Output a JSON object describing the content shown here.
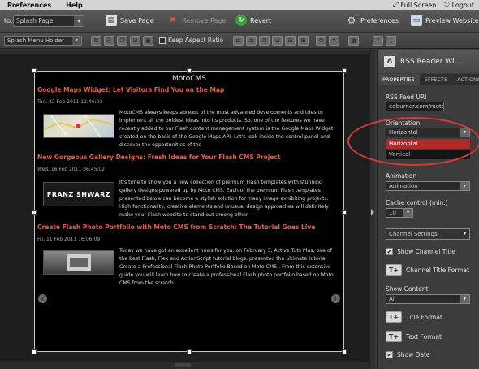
{
  "menubar": {
    "items": [
      "Preferences",
      "Help"
    ],
    "full_screen": "Full Screen",
    "logout": "Logout"
  },
  "toolbar": {
    "to_label": "to:",
    "page_select": "Splash Page",
    "save_page": "Save Page",
    "remove_page": "Remove Page",
    "revert": "Revert",
    "preferences": "Preferences",
    "preview_website": "Preview Website"
  },
  "toolbar2": {
    "holder_select": "Splash Menu Holder",
    "keep_aspect_ratio": "Keep Aspect Ratio"
  },
  "widget": {
    "title": "MotoCMS",
    "posts": [
      {
        "title": "Google Maps Widget: Let Visitors Find You on the Map",
        "date": "Tue, 22 Feb 2011 12:46:03",
        "body": "MotoCMS always keeps abreast of the most advanced developments and tries to implement all the boldest ideas into its products. So, one of the features we have recently added to our Flash content management system is the Google Maps Widget created on the basis of the Google Maps API. Let's look inside the control panel and discover the opportunities of the",
        "thumb_caption": ""
      },
      {
        "title": "New Gorgeous Gallery Designs: Fresh Ideas for Your Flash CMS Project",
        "date": "Wed, 16 Feb 2011 06:45:02",
        "body": "It's time to show you a new collection of premium Flash templates with stunning gallery designs powered up by Moto CMS. Each of the premium Flash templates presented below can become a stylish solution for many image exhibiting projects. High functionality, creative elements and unusual design approaches will definitely make your Flash website to stand out among other",
        "thumb_caption": "FRANZ SHWARZ"
      },
      {
        "title": "Create Flash Photo Portfolio with Moto CMS from Scratch: The Tutorial Goes Live",
        "date": "Fri, 11 Feb 2011 16:06:09",
        "body": "Today we have got an excellent news for you: on February 3, Active Tuts Plus, one of the best Flash, Flex and ActionScript tutorial blogs, presented the ultimate tutorial Create a Professional Flash Photo Portfolio Based on Moto CMS . From this extensive guide you will learn how to create a professional Flash photo portfolio based on Moto CMS from the scratch.",
        "thumb_caption": ""
      }
    ]
  },
  "panel": {
    "title": "RSS Reader Wi...",
    "tabs": [
      "PROPERTIES",
      "EFFECTS",
      "ACTIONS"
    ],
    "rss_feed_uri_label": "RSS Feed URI",
    "rss_feed_uri_value": "edburner.com/motocms/",
    "orientation_label": "Orientation",
    "orientation_value": "Horizontal",
    "orientation_options": [
      "Horizontal",
      "Vertical"
    ],
    "animation_label": "Animation",
    "animation_value": "Animation",
    "cache_label": "Cache control (min.)",
    "cache_value": "10",
    "channel_settings": "Channel Settings",
    "show_channel_title": "Show Channel Title",
    "channel_title_format": "Channel Title Format",
    "show_content_label": "Show Content",
    "show_content_value": "All",
    "title_format": "Title Format",
    "text_format": "Text Format",
    "show_date": "Show Date"
  },
  "colors": {
    "accent_red": "#d83a3a",
    "post_title": "#e65e4a",
    "selected_option": "#b22929"
  }
}
